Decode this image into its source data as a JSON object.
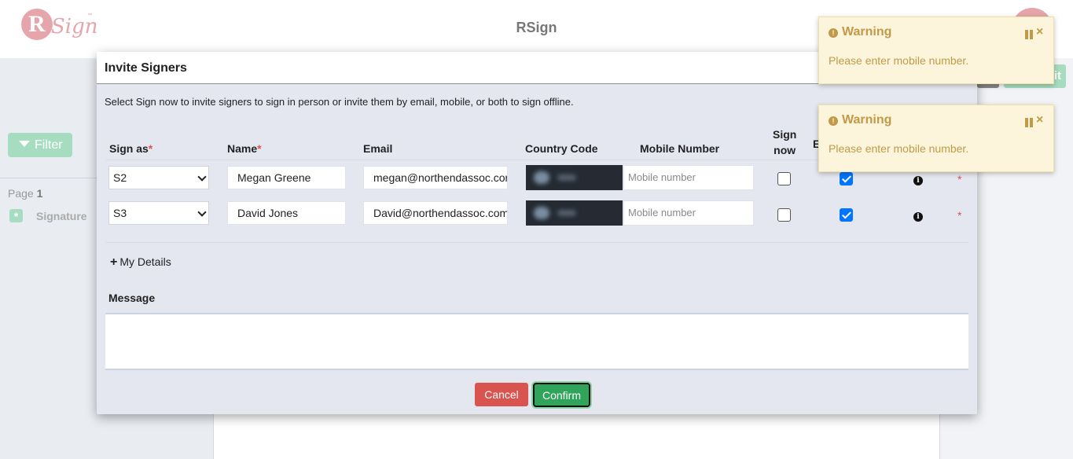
{
  "app": {
    "title": "RSign",
    "logo_letter": "R",
    "logo_word": "Sign",
    "logo_tm": "™"
  },
  "sidebar": {
    "filter_label": "Filter",
    "page_label": "Page",
    "page_number": "1",
    "signature_label": "Signature",
    "signature_icon": "*"
  },
  "background": {
    "toolbar_button_label": "it"
  },
  "modal": {
    "title": "Invite Signers",
    "intro": "Select Sign now to invite signers to sign in person or invite them by email, mobile, or both to sign offline.",
    "columns": {
      "sign_as": "Sign as",
      "name": "Name",
      "email": "Email",
      "country_code": "Country Code",
      "mobile_number": "Mobile Number",
      "sign_now_line1": "Sign",
      "sign_now_line2": "now",
      "email_partial": "E",
      "required_marker": "*"
    },
    "rows": [
      {
        "sign_as": "S2",
        "name": "Megan Greene",
        "email": "megan@northendassoc.com",
        "mobile_placeholder": "Mobile number",
        "sign_now": false,
        "email_checked": true
      },
      {
        "sign_as": "S3",
        "name": "David Jones",
        "email": "David@northendassoc.com",
        "mobile_placeholder": "Mobile number",
        "sign_now": false,
        "email_checked": true
      }
    ],
    "my_details": "My Details",
    "my_details_icon": "+",
    "message_label": "Message",
    "message_value": "",
    "cancel_label": "Cancel",
    "confirm_label": "Confirm"
  },
  "toasts": [
    {
      "title": "Warning",
      "message": "Please enter mobile number.",
      "close": "×"
    },
    {
      "title": "Warning",
      "message": "Please enter mobile number.",
      "close": "×"
    }
  ],
  "colors": {
    "warning": "#c09a48",
    "cancel": "#d9534f",
    "confirm": "#2fa45a",
    "accent_green": "#a6dcc0"
  }
}
